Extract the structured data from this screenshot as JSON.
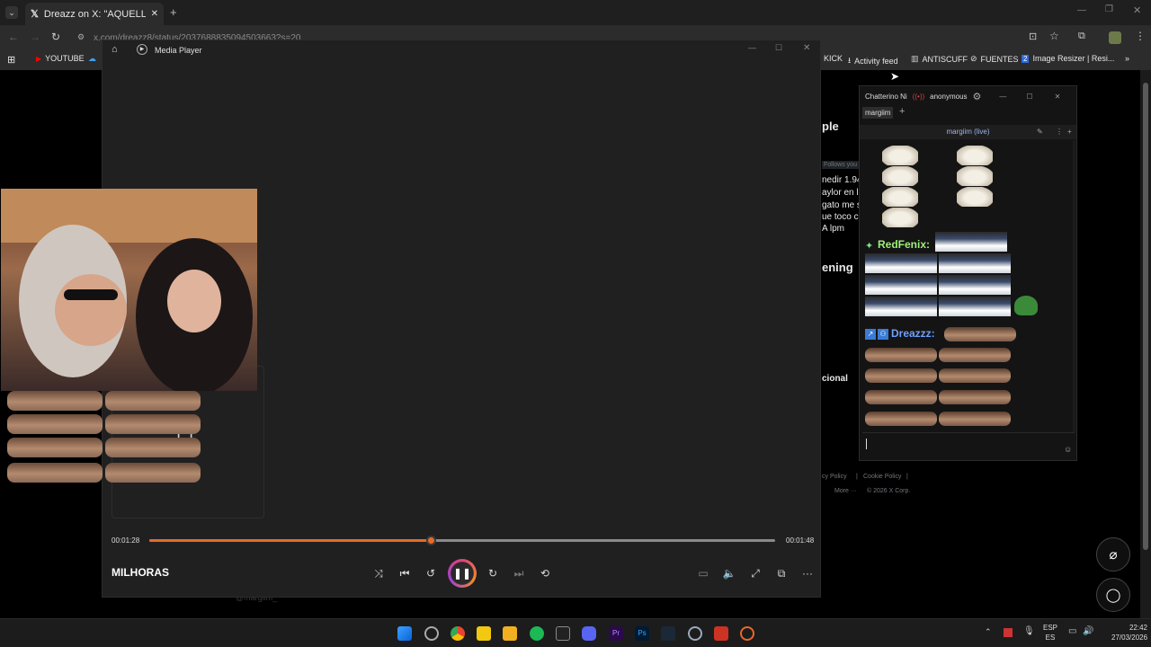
{
  "browser": {
    "tab_title": "Dreazz on X: \"AQUELLA NOCHE",
    "url": "x.com/dreazz8/status/2037688835094503663?s=20",
    "bookmarks": {
      "youtube": "YOUTUBE",
      "kick": "KICK",
      "activity_feed": "Activity feed",
      "antiscuff": "ANTISCUFF",
      "fuentes": "FUENTES",
      "image_resizer": "Image Resizer | Resi..."
    }
  },
  "background_page": {
    "heading_1": "ple",
    "follows_you": "Follows you",
    "lines": [
      "nedir 1.94",
      "aylor en la",
      "gato me s",
      "ue toco c",
      "A lpm"
    ],
    "heading_2": "ening",
    "heading_3": "cional",
    "footer": {
      "privacy": "cy Policy",
      "sep1": "|",
      "cookie": "Cookie Policy",
      "sep2": "|",
      "more": "More ···",
      "copyright": "© 2026 X Corp."
    },
    "bottom_user": "@margiim_"
  },
  "media_player": {
    "title": "Media Player",
    "current_time": "00:01:28",
    "total_time": "00:01:48",
    "progress": 0.45,
    "track_title": "MILHORAS",
    "accent": "#e8692a"
  },
  "chatterino": {
    "title": "Chatterino Ni",
    "account": "anonymous",
    "tab": "margiim",
    "channel": "margiim (live)",
    "users": [
      {
        "name": "RedFenix:",
        "color": "#9ef07a"
      },
      {
        "name": "Dreazzz:",
        "color": "#6fa0ff"
      }
    ]
  },
  "taskbar": {
    "lang_top": "ESP",
    "lang_bottom": "ES",
    "time": "22:42",
    "date": "27/03/2026"
  }
}
